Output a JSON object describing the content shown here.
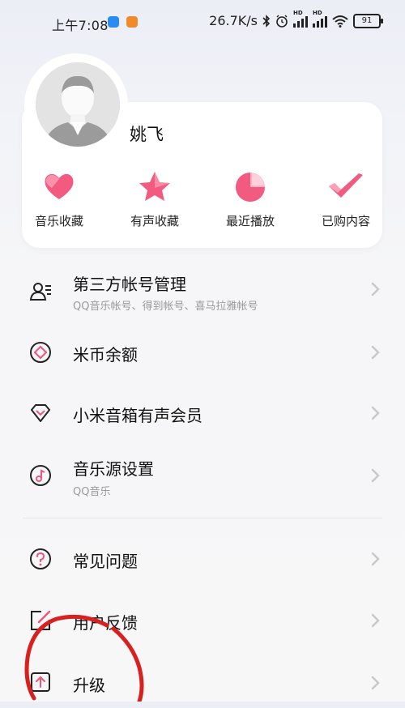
{
  "status_bar": {
    "time": "上午7:08",
    "net_speed": "26.7K/s",
    "hd1": "HD",
    "hd2": "HD",
    "battery": "91"
  },
  "profile": {
    "username": "姚飞",
    "quick_actions": [
      {
        "label": "音乐收藏",
        "icon": "heart-icon"
      },
      {
        "label": "有声收藏",
        "icon": "star-icon"
      },
      {
        "label": "最近播放",
        "icon": "pie-clock-icon"
      },
      {
        "label": "已购内容",
        "icon": "checkmark-icon"
      }
    ],
    "accent_color": "#f0557a"
  },
  "menu": [
    {
      "title": "第三方帐号管理",
      "subtitle": "QQ音乐帐号、得到帐号、喜马拉雅帐号",
      "icon": "account-list-icon"
    },
    {
      "title": "米币余额",
      "icon": "coin-diamond-icon"
    },
    {
      "title": "小米音箱有声会员",
      "icon": "gem-icon"
    },
    {
      "title": "音乐源设置",
      "subtitle": "QQ音乐",
      "icon": "music-note-icon"
    },
    {
      "title": "常见问题",
      "icon": "question-icon"
    },
    {
      "title": "用户反馈",
      "icon": "feedback-edit-icon"
    },
    {
      "title": "升级",
      "icon": "upgrade-arrow-icon"
    }
  ]
}
